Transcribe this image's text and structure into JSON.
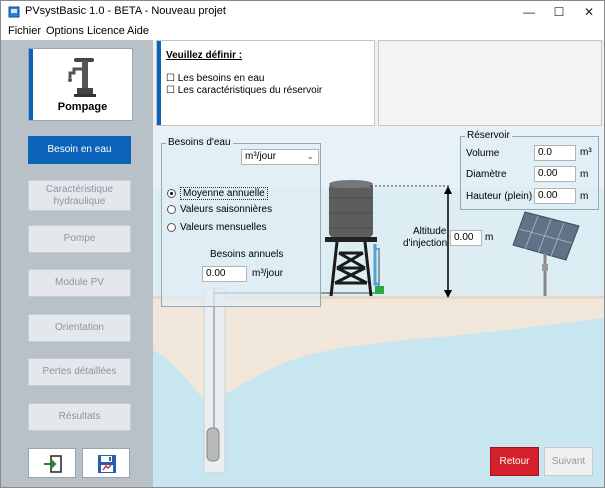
{
  "window": {
    "title": "PVsystBasic 1.0 - BETA - Nouveau projet",
    "minimize": "—",
    "maximize": "☐",
    "close": "✕"
  },
  "menu": [
    "Fichier",
    "Options",
    "Licence",
    "Aide"
  ],
  "sidebar": {
    "card_label": "Pompage",
    "card_icon": "water-pump-icon",
    "items": [
      {
        "label": "Besoin en eau",
        "active": true
      },
      {
        "label": "Caractéristique hydraulique",
        "active": false
      },
      {
        "label": "Pompe",
        "active": false
      },
      {
        "label": "Module PV",
        "active": false
      },
      {
        "label": "Orientation",
        "active": false
      },
      {
        "label": "Pertes détaillées",
        "active": false
      },
      {
        "label": "Résultats",
        "active": false
      }
    ],
    "bottom_icons": [
      "import-icon",
      "save-icon"
    ]
  },
  "info": {
    "title": "Veuillez définir :",
    "lines": [
      "☐ Les besoins en eau",
      "☐ Les caractéristiques du réservoir"
    ]
  },
  "besoins": {
    "title": "Besoins d'eau",
    "unit_select": "m³/jour",
    "options": [
      {
        "label": "Moyenne annuelle",
        "selected": true
      },
      {
        "label": "Valeurs saisonnières",
        "selected": false
      },
      {
        "label": "Valeurs mensuelles",
        "selected": false
      }
    ],
    "annual_label": "Besoins annuels",
    "annual_value": "0.00",
    "annual_unit": "m³/jour"
  },
  "reservoir": {
    "title": "Réservoir",
    "rows": [
      {
        "label": "Volume",
        "value": "0.0",
        "unit": "m³"
      },
      {
        "label": "Diamètre",
        "value": "0.00",
        "unit": "m"
      },
      {
        "label": "Hauteur (plein)",
        "value": "0.00",
        "unit": "m"
      }
    ]
  },
  "altitude": {
    "label_line1": "Altitude",
    "label_line2": "d'injection",
    "value": "0.00",
    "unit": "m"
  },
  "buttons": {
    "retour": "Retour",
    "suivant": "Suivant"
  },
  "colors": {
    "accent": "#0a63b9",
    "retour": "#d3202a",
    "sky": "#dcedf4",
    "water": "#c8e6f0",
    "ground": "#f1e6da"
  }
}
